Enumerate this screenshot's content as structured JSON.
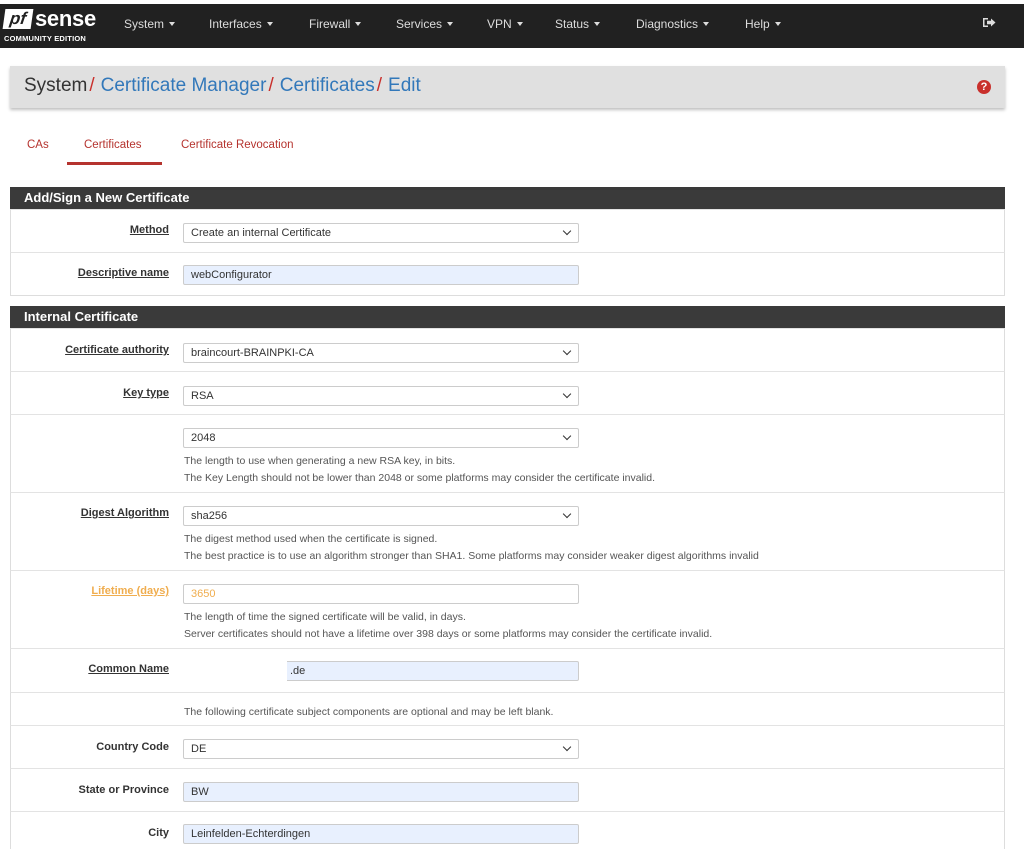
{
  "nav": {
    "logo_main": "sense",
    "logo_pf": "pf",
    "logo_edition": "COMMUNITY EDITION",
    "items": [
      "System",
      "Interfaces",
      "Firewall",
      "Services",
      "VPN",
      "Status",
      "Diagnostics",
      "Help"
    ]
  },
  "breadcrumb": {
    "root": "System",
    "sep": "/",
    "level1": "Certificate Manager",
    "level2": "Certificates",
    "level3": "Edit"
  },
  "tabs": [
    "CAs",
    "Certificates",
    "Certificate Revocation"
  ],
  "panel1": {
    "title": "Add/Sign a New Certificate",
    "method_label": "Method",
    "method_value": "Create an internal Certificate",
    "descr_label": "Descriptive name",
    "descr_value": "webConfigurator"
  },
  "panel2": {
    "title": "Internal Certificate",
    "ca_label": "Certificate authority",
    "ca_value": "braincourt-BRAINPKI-CA",
    "keytype_label": "Key type",
    "keytype_value": "RSA",
    "keylen_value": "2048",
    "keylen_help1": "The length to use when generating a new RSA key, in bits.",
    "keylen_help2": "The Key Length should not be lower than 2048 or some platforms may consider the certificate invalid.",
    "digest_label": "Digest Algorithm",
    "digest_value": "sha256",
    "digest_help1": "The digest method used when the certificate is signed.",
    "digest_help2": "The best practice is to use an algorithm stronger than SHA1. Some platforms may consider weaker digest algorithms invalid",
    "lifetime_label": "Lifetime (days)",
    "lifetime_value": "3650",
    "lifetime_help1": "The length of time the signed certificate will be valid, in days.",
    "lifetime_help2": "Server certificates should not have a lifetime over 398 days or some platforms may consider the certificate invalid.",
    "cn_label": "Common Name",
    "cn_value": ".de",
    "optional_note": "The following certificate subject components are optional and may be left blank.",
    "country_label": "Country Code",
    "country_value": "DE",
    "state_label": "State or Province",
    "state_value": "BW",
    "city_label": "City",
    "city_value": "Leinfelden-Echterdingen"
  },
  "colors": {
    "accent": "#b5332e",
    "link": "#3278ba",
    "warning": "#f0ad4e",
    "navbar": "#212121"
  }
}
